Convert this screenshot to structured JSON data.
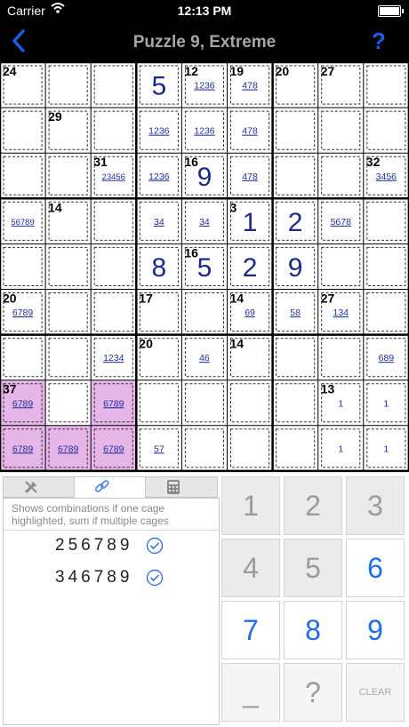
{
  "status_bar": {
    "carrier": "Carrier",
    "time": "12:13 PM"
  },
  "nav": {
    "title": "Puzzle 9, Extreme",
    "help_label": "?"
  },
  "colors": {
    "accent_blue": "#1a5de6",
    "cage_highlight": "#e7b6e8",
    "digit_blue": "#1b2a8a",
    "candidate_blue": "#1e2f9a"
  },
  "grid": {
    "given_digits": [
      {
        "r": 0,
        "c": 3,
        "v": "5"
      },
      {
        "r": 2,
        "c": 4,
        "v": "9"
      },
      {
        "r": 3,
        "c": 5,
        "v": "1"
      },
      {
        "r": 3,
        "c": 6,
        "v": "2"
      },
      {
        "r": 4,
        "c": 3,
        "v": "8"
      },
      {
        "r": 4,
        "c": 4,
        "v": "5"
      },
      {
        "r": 4,
        "c": 5,
        "v": "2"
      },
      {
        "r": 4,
        "c": 6,
        "v": "9"
      }
    ],
    "candidates": [
      {
        "r": 0,
        "c": 4,
        "v": "1236"
      },
      {
        "r": 0,
        "c": 5,
        "v": "478"
      },
      {
        "r": 1,
        "c": 3,
        "v": "1236"
      },
      {
        "r": 1,
        "c": 4,
        "v": "1236"
      },
      {
        "r": 1,
        "c": 5,
        "v": "478"
      },
      {
        "r": 2,
        "c": 2,
        "v": "23456"
      },
      {
        "r": 2,
        "c": 3,
        "v": "1236"
      },
      {
        "r": 2,
        "c": 5,
        "v": "478"
      },
      {
        "r": 2,
        "c": 8,
        "v": "3456"
      },
      {
        "r": 3,
        "c": 0,
        "v": "56789"
      },
      {
        "r": 3,
        "c": 3,
        "v": "34"
      },
      {
        "r": 3,
        "c": 4,
        "v": "34"
      },
      {
        "r": 3,
        "c": 7,
        "v": "5678"
      },
      {
        "r": 5,
        "c": 0,
        "v": "6789"
      },
      {
        "r": 5,
        "c": 5,
        "v": "69"
      },
      {
        "r": 5,
        "c": 6,
        "v": "58"
      },
      {
        "r": 5,
        "c": 7,
        "v": "134"
      },
      {
        "r": 6,
        "c": 2,
        "v": "1234"
      },
      {
        "r": 6,
        "c": 4,
        "v": "46"
      },
      {
        "r": 6,
        "c": 8,
        "v": "689"
      },
      {
        "r": 7,
        "c": 0,
        "v": "6789"
      },
      {
        "r": 7,
        "c": 2,
        "v": "6789"
      },
      {
        "r": 7,
        "c": 7,
        "v": "1"
      },
      {
        "r": 7,
        "c": 8,
        "v": "1"
      },
      {
        "r": 8,
        "c": 0,
        "v": "6789"
      },
      {
        "r": 8,
        "c": 1,
        "v": "6789"
      },
      {
        "r": 8,
        "c": 2,
        "v": "6789"
      },
      {
        "r": 8,
        "c": 3,
        "v": "57"
      },
      {
        "r": 8,
        "c": 7,
        "v": "1"
      },
      {
        "r": 8,
        "c": 8,
        "v": "1"
      }
    ],
    "cage_sums": [
      {
        "r": 0,
        "c": 0,
        "v": "24"
      },
      {
        "r": 0,
        "c": 4,
        "v": "12"
      },
      {
        "r": 0,
        "c": 5,
        "v": "19"
      },
      {
        "r": 0,
        "c": 6,
        "v": "20"
      },
      {
        "r": 0,
        "c": 7,
        "v": "27"
      },
      {
        "r": 1,
        "c": 1,
        "v": "29"
      },
      {
        "r": 2,
        "c": 2,
        "v": "31"
      },
      {
        "r": 2,
        "c": 4,
        "v": "16"
      },
      {
        "r": 2,
        "c": 8,
        "v": "32"
      },
      {
        "r": 3,
        "c": 1,
        "v": "14"
      },
      {
        "r": 3,
        "c": 5,
        "v": "3"
      },
      {
        "r": 4,
        "c": 4,
        "v": "16"
      },
      {
        "r": 5,
        "c": 0,
        "v": "20"
      },
      {
        "r": 5,
        "c": 3,
        "v": "17"
      },
      {
        "r": 5,
        "c": 5,
        "v": "14"
      },
      {
        "r": 5,
        "c": 7,
        "v": "27"
      },
      {
        "r": 6,
        "c": 3,
        "v": "20"
      },
      {
        "r": 6,
        "c": 5,
        "v": "14"
      },
      {
        "r": 7,
        "c": 0,
        "v": "37"
      },
      {
        "r": 7,
        "c": 7,
        "v": "13"
      }
    ],
    "highlighted_cells": [
      [
        7,
        0
      ],
      [
        7,
        2
      ],
      [
        8,
        0
      ],
      [
        8,
        1
      ],
      [
        8,
        2
      ]
    ]
  },
  "tabs": [
    {
      "name": "tools",
      "icon": "tools-icon",
      "active": false
    },
    {
      "name": "combinations",
      "icon": "link-icon",
      "active": true
    },
    {
      "name": "calculator",
      "icon": "calculator-icon",
      "active": false
    }
  ],
  "combinations_panel": {
    "hint": "Shows combinations if one cage highlighted, sum if multiple cages",
    "combos": [
      "256789",
      "346789"
    ]
  },
  "keypad": {
    "keys": [
      "1",
      "2",
      "3",
      "4",
      "5",
      "6",
      "7",
      "8",
      "9",
      "_",
      "?",
      "CLEAR"
    ],
    "active_keys": [
      "6",
      "7",
      "8",
      "9"
    ]
  }
}
